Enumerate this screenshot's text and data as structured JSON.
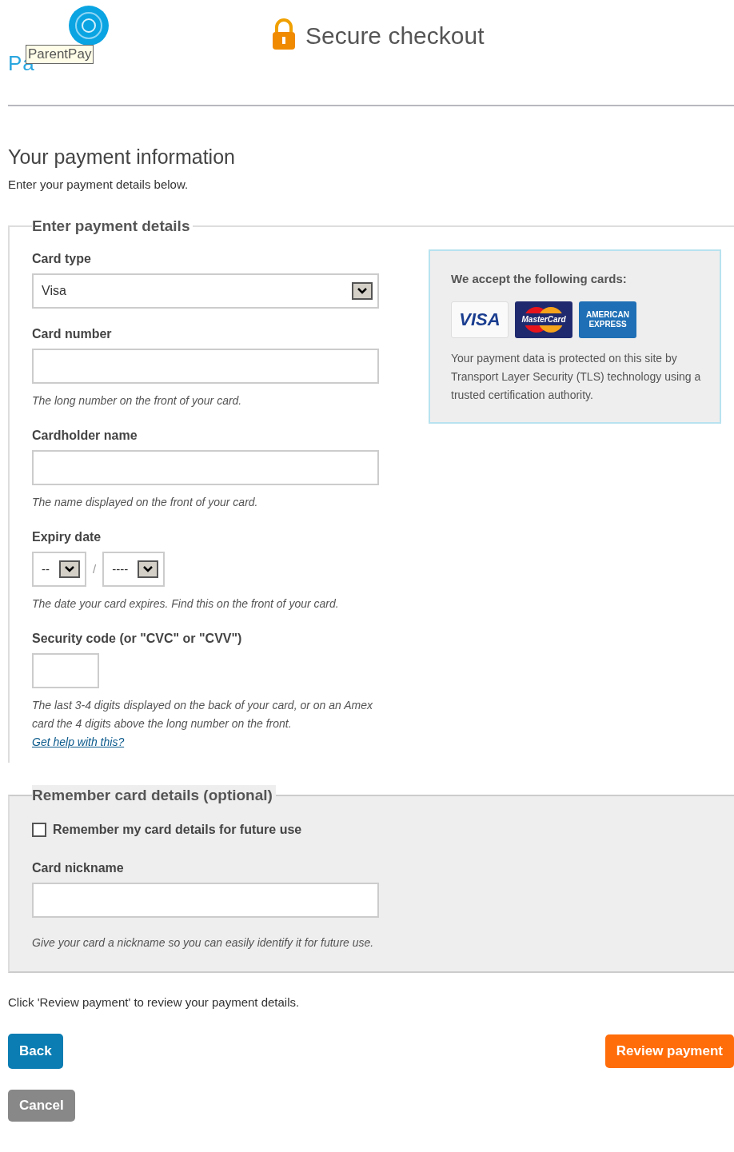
{
  "header": {
    "logo": {
      "text": "Pa",
      "tooltip": "ParentPay"
    },
    "title": "Secure checkout"
  },
  "heading": "Your payment information",
  "subheading": "Enter your payment details below.",
  "payment_details": {
    "legend": "Enter payment details",
    "fields": [
      {
        "kind": "select",
        "label": "Card type",
        "value": "Visa"
      },
      {
        "kind": "input",
        "label": "Card number",
        "hint": "The long number on the front of your card."
      },
      {
        "kind": "input",
        "label": "Cardholder name",
        "hint": "The name displayed on the front of your card."
      },
      {
        "kind": "expiry",
        "label": "Expiry date",
        "month": "--",
        "separator": "/",
        "year": "----",
        "hint": "The date your card expires. Find this on the front of your card."
      },
      {
        "kind": "short",
        "label": "Security code (or \"CVC\" or \"CVV\")",
        "hint": "The last 3-4 digits displayed on the back of your card, or on an Amex card the 4 digits above the long number on the front.",
        "link": "Get help with this?"
      }
    ]
  },
  "cards_box": {
    "title": "We accept the following cards:",
    "cards": [
      {
        "kind": "visa",
        "name": "VISA"
      },
      {
        "kind": "mastercard",
        "name": "MasterCard"
      },
      {
        "kind": "amex",
        "name": "AMERICAN EXPRESS"
      }
    ],
    "note": "Your payment data is protected on this site by Transport Layer Security (TLS) technology using a trusted certification authority."
  },
  "remember": {
    "legend": "Remember card details (optional)",
    "checkbox": {
      "label": "Remember my card details for future use",
      "checked": false
    },
    "field": {
      "label": "Card nickname",
      "hint": "Give your card a nickname so you can easily identify it for future use."
    }
  },
  "footer_text": "Click 'Review payment' to review your payment details.",
  "buttons": [
    {
      "kind": "primary",
      "label": "Back"
    },
    {
      "kind": "accent",
      "label": "Review payment"
    },
    {
      "kind": "secondary",
      "label": "Cancel"
    }
  ]
}
